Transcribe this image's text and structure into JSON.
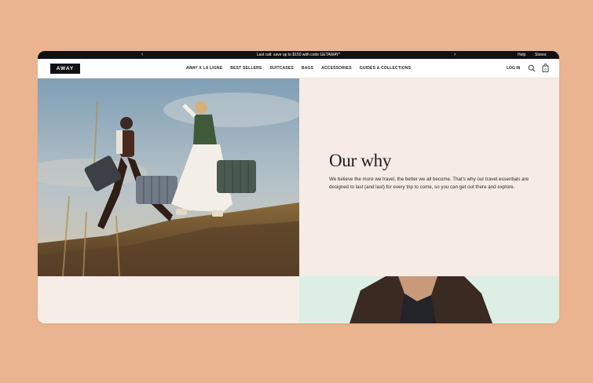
{
  "announcement": {
    "message": "Last call: save up to $150 with code GETAWAY*",
    "prev_arrow": "‹",
    "next_arrow": "›",
    "help": "Help",
    "stores": "Stores"
  },
  "nav": {
    "logo": "AWAY",
    "items": [
      {
        "label": "AWAY X LA LIGNE"
      },
      {
        "label": "BEST SELLERS"
      },
      {
        "label": "SUITCASES"
      },
      {
        "label": "BAGS"
      },
      {
        "label": "ACCESSORIES"
      },
      {
        "label": "GUIDES & COLLECTIONS"
      }
    ],
    "login": "LOG IN",
    "cart_count": "0",
    "icons": [
      "search-icon",
      "bag-icon"
    ]
  },
  "hero": {
    "title": "Our why",
    "body": "We believe the more we travel, the better we all become. That's why our travel essentials are designed to last (and last) for every trip to come, so you can get out there and explore."
  },
  "colors": {
    "page_background": "#ebb490",
    "announcement_bar": "#111111",
    "hero_panel": "#f6ebe5",
    "lower_right_panel": "#ddeee4"
  }
}
